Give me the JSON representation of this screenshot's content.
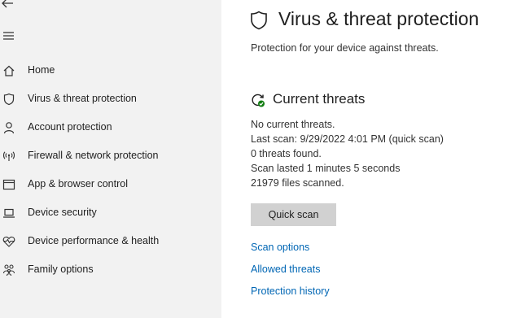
{
  "nav": {
    "back_icon": "back-arrow-icon",
    "menu_icon": "hamburger-menu-icon",
    "items": [
      {
        "label": "Home",
        "icon": "home-icon"
      },
      {
        "label": "Virus & threat protection",
        "icon": "shield-icon"
      },
      {
        "label": "Account protection",
        "icon": "person-icon"
      },
      {
        "label": "Firewall & network protection",
        "icon": "antenna-icon"
      },
      {
        "label": "App & browser control",
        "icon": "app-window-icon"
      },
      {
        "label": "Device security",
        "icon": "laptop-icon"
      },
      {
        "label": "Device performance & health",
        "icon": "heart-pulse-icon"
      },
      {
        "label": "Family options",
        "icon": "family-icon"
      }
    ]
  },
  "main": {
    "title": "Virus & threat protection",
    "subtitle": "Protection for your device against threats.",
    "current_threats": {
      "title": "Current threats",
      "status_icon": "refresh-check-icon",
      "lines": [
        "No current threats.",
        "Last scan: 9/29/2022 4:01 PM (quick scan)",
        "0 threats found.",
        "Scan lasted 1 minutes 5 seconds",
        "21979 files scanned."
      ],
      "quick_scan_label": "Quick scan"
    },
    "links": {
      "scan_options": "Scan options",
      "allowed_threats": "Allowed threats",
      "protection_history": "Protection history"
    }
  },
  "colors": {
    "sidebar_bg": "#f2f2f2",
    "link": "#0066b4",
    "button_bg": "#d1d1d1",
    "status_ok": "#107c10"
  }
}
